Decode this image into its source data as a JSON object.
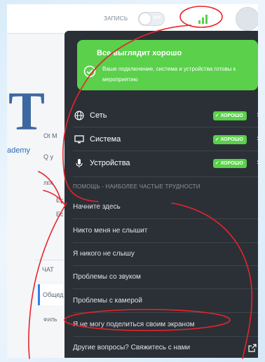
{
  "topbar": {
    "record_label": "ЗАПИСЬ",
    "record_toggle_state": "OFF"
  },
  "background": {
    "logo_letter": "T",
    "logo_text": "ademy",
    "ghost_texts": [
      "Ot M",
      "Q y",
      "ЛЕК",
      "Ec",
      "Ec",
      "ЧАТ",
      "Общед",
      "ФИЛЬ"
    ]
  },
  "status": {
    "title": "Все выглядит хорошо",
    "description": "Ваше подключение, система и устройства готовы к мероприятию",
    "color": "#5ad04b"
  },
  "checks": [
    {
      "label": "Сеть",
      "badge": "ХОРОШО",
      "icon": "globe-icon"
    },
    {
      "label": "Система",
      "badge": "ХОРОШО",
      "icon": "monitor-icon"
    },
    {
      "label": "Устройства",
      "badge": "ХОРОШО",
      "icon": "microphone-icon"
    }
  ],
  "help": {
    "header": "ПОМОЩЬ - НАИБОЛЕЕ ЧАСТЫЕ ТРУДНОСТИ",
    "items": [
      "Начните здесь",
      "Никто меня не слышит",
      "Я никого не слышу",
      "Проблемы со звуком",
      "Проблемы с камерой",
      "Я не могу поделиться своим экраном"
    ],
    "footer": "Другие вопросы? Свяжитесь с нами"
  }
}
